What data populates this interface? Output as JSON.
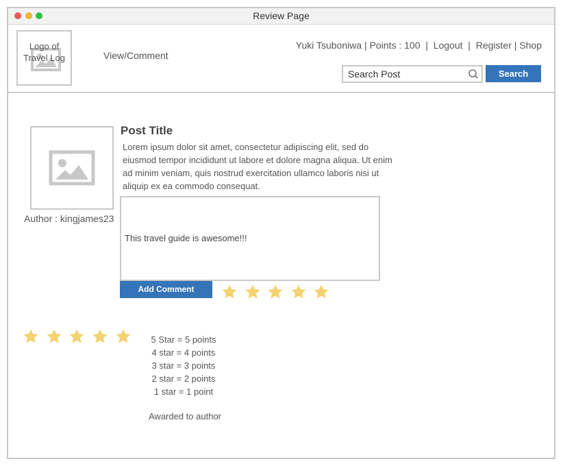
{
  "window": {
    "title": "Review Page"
  },
  "header": {
    "logo_text": "Logo of Travel Log",
    "nav_link": "View/Comment",
    "user_name": "Yuki Tsuboniwa",
    "points_label": "Points : 100",
    "logout_label": "Logout",
    "register_label": "Register",
    "shop_label": "Shop",
    "search_placeholder": "Search Post",
    "search_button": "Search"
  },
  "post": {
    "title": "Post Title",
    "body": "Lorem ipsum dolor sit amet, consectetur adipiscing elit, sed do eiusmod tempor incididunt ut labore et dolore magna aliqua. Ut enim ad minim veniam, quis nostrud exercitation ullamco laboris nisi ut aliquip ex ea commodo consequat.",
    "author": "Author : kingjames23",
    "comment_value": "This travel guide is awesome!!!",
    "add_comment_button": "Add Comment",
    "rating_stars": 5
  },
  "legend": {
    "stars": 5,
    "lines": [
      "5 Star = 5 points",
      "4 star = 4 points",
      "3 star = 3 points",
      "2 star = 2 points",
      "1 star = 1 point"
    ],
    "awarded": "Awarded to author"
  },
  "colors": {
    "accent": "#3574b8",
    "star": "#f3d270",
    "border": "#c8c8c8"
  }
}
